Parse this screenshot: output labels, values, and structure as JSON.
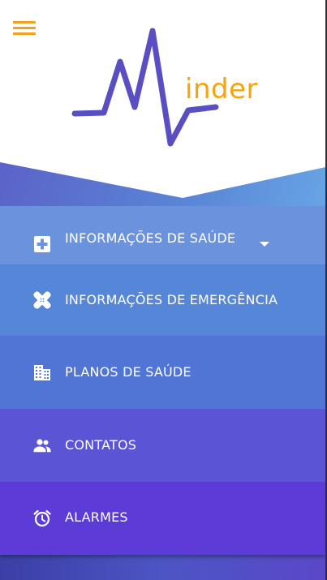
{
  "app": {
    "logo_text": "inder"
  },
  "colors": {
    "accent": "#f5a30f",
    "logo_line": "#5a4fc2"
  },
  "icons": {
    "menu": "hamburger-icon",
    "health_info": "medical-plus-icon",
    "emergency_info": "bandage-icon",
    "health_plans": "building-icon",
    "contacts": "people-icon",
    "alarms": "alarm-clock-icon",
    "expand": "caret-down-icon"
  },
  "menu": {
    "items": [
      {
        "label": "INFORMAÇÕES DE SAÚDE"
      },
      {
        "label": "INFORMAÇÕES DE EMERGÊNCIA"
      },
      {
        "label": "PLANOS DE SAÚDE"
      },
      {
        "label": "CONTATOS"
      },
      {
        "label": "ALARMES"
      }
    ]
  }
}
